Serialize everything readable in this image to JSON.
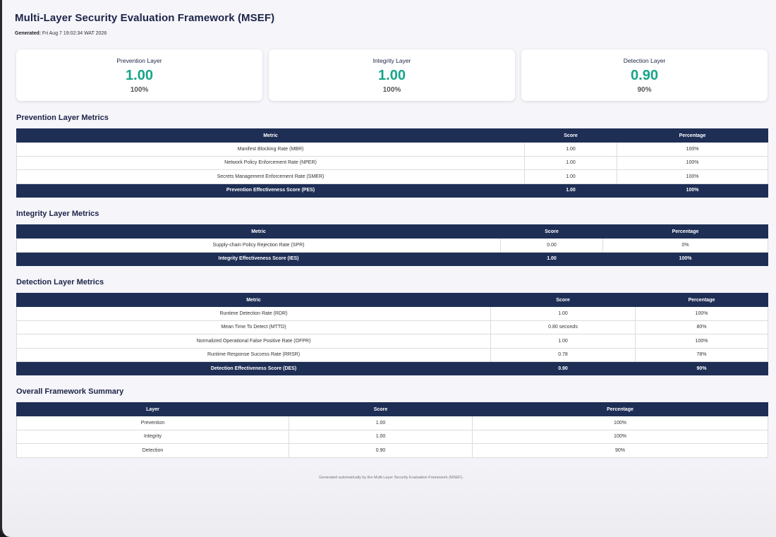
{
  "header": {
    "title": "Multi-Layer Security Evaluation Framework (MSEF)",
    "generated_label": "Generated:",
    "generated_value": "Fri Aug 7 19:02:34 WAT 2026"
  },
  "cards": [
    {
      "title": "Prevention Layer",
      "score": "1.00",
      "percent": "100%"
    },
    {
      "title": "Integrity Layer",
      "score": "1.00",
      "percent": "100%"
    },
    {
      "title": "Detection Layer",
      "score": "0.90",
      "percent": "90%"
    }
  ],
  "prevention": {
    "title": "Prevention Layer Metrics",
    "headers": [
      "Metric",
      "Score",
      "Percentage"
    ],
    "rows": [
      [
        "Manifest Blocking Rate (MBR)",
        "1.00",
        "100%"
      ],
      [
        "Network Policy Enforcement Rate (NPER)",
        "1.00",
        "100%"
      ],
      [
        "Secrets Management Enforcement Rate (SMER)",
        "1.00",
        "100%"
      ]
    ],
    "total": [
      "Prevention Effectiveness Score (PES)",
      "1.00",
      "100%"
    ]
  },
  "integrity": {
    "title": "Integrity Layer Metrics",
    "headers": [
      "Metric",
      "Score",
      "Percentage"
    ],
    "rows": [
      [
        "Supply-chain Policy Rejection Rate (SPR)",
        "0.00",
        "0%"
      ]
    ],
    "total": [
      "Integrity Effectiveness Score (IES)",
      "1.00",
      "100%"
    ]
  },
  "detection": {
    "title": "Detection Layer Metrics",
    "headers": [
      "Metric",
      "Score",
      "Percentage"
    ],
    "rows": [
      [
        "Runtime Detection Rate (RDR)",
        "1.00",
        "100%"
      ],
      [
        "Mean Time To Detect (MTTD)",
        "0.80 seconds",
        "80%"
      ],
      [
        "Normalized Operational False Positive Rate (OFPR)",
        "1.00",
        "100%"
      ],
      [
        "Runtime Response Success Rate (RRSR)",
        "0.78",
        "78%"
      ]
    ],
    "total": [
      "Detection Effectiveness Score (DES)",
      "0.90",
      "90%"
    ]
  },
  "summary": {
    "title": "Overall Framework Summary",
    "headers": [
      "Layer",
      "Score",
      "Percentage"
    ],
    "rows": [
      [
        "Prevention",
        "1.00",
        "100%"
      ],
      [
        "Integrity",
        "1.00",
        "100%"
      ],
      [
        "Detection",
        "0.90",
        "90%"
      ]
    ]
  },
  "footer": "Generated automatically by the Multi-Layer Security Evaluation Framework (MSEF).",
  "colors": {
    "accent": "#17a589",
    "header_bg": "#1e2e55",
    "title": "#1c2447"
  }
}
